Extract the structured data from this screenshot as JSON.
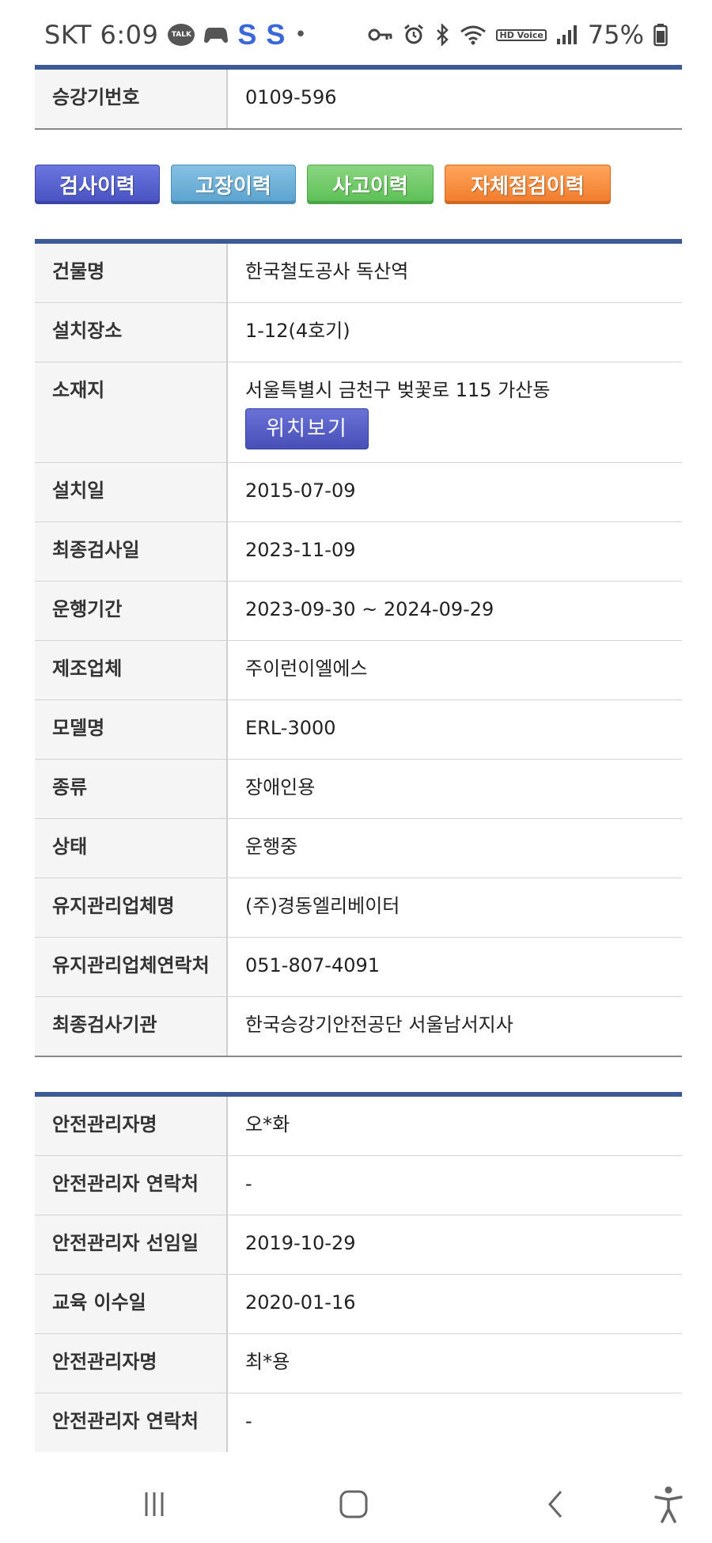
{
  "status_bar": {
    "carrier_time": "SKT 6:09",
    "talk_badge": "TALK",
    "s_icon_1": "S",
    "s_icon_2": "S",
    "dot": "•",
    "hd_voice": "HD Voice",
    "battery": "75%",
    "icons": [
      "talk-icon",
      "game-icon",
      "s-icon",
      "s-icon",
      "key-icon",
      "alarm-icon",
      "bluetooth-icon",
      "wifi-icon",
      "hd-voice-icon",
      "signal-icon",
      "battery-icon"
    ]
  },
  "top_table": {
    "rows": [
      {
        "label": "승강기번호",
        "value": "0109-596"
      }
    ]
  },
  "history_buttons": {
    "inspection": "검사이력",
    "fault": "고장이력",
    "accident": "사고이력",
    "self_check": "자체점검이력"
  },
  "info_table": {
    "building_label": "건물명",
    "building_value": "한국철도공사 독산역",
    "location_label": "설치장소",
    "location_value": "1-12(4호기)",
    "address_label": "소재지",
    "address_value": "서울특별시 금천구 벚꽃로 115 가산동",
    "map_button": "위치보기",
    "rows": [
      {
        "label": "설치일",
        "value": "2015-07-09"
      },
      {
        "label": "최종검사일",
        "value": "2023-11-09"
      },
      {
        "label": "운행기간",
        "value": "2023-09-30 ~ 2024-09-29"
      },
      {
        "label": "제조업체",
        "value": "주이런이엘에스"
      },
      {
        "label": "모델명",
        "value": "ERL-3000"
      },
      {
        "label": "종류",
        "value": "장애인용"
      },
      {
        "label": "상태",
        "value": "운행중"
      },
      {
        "label": "유지관리업체명",
        "value": "(주)경동엘리베이터"
      },
      {
        "label": "유지관리업체연락처",
        "value": "051-807-4091"
      },
      {
        "label": "최종검사기관",
        "value": "한국승강기안전공단 서울남서지사"
      }
    ]
  },
  "manager_table": {
    "rows": [
      {
        "label": "안전관리자명",
        "value": "오*화"
      },
      {
        "label": "안전관리자 연락처",
        "value": "-"
      },
      {
        "label": "안전관리자 선임일",
        "value": "2019-10-29"
      },
      {
        "label": "교육 이수일",
        "value": "2020-01-16"
      },
      {
        "label": "안전관리자명",
        "value": "최*용"
      },
      {
        "label": "안전관리자 연락처",
        "value": "-"
      }
    ]
  },
  "nav_bar": {
    "icons": [
      "recent-apps-icon",
      "home-icon",
      "back-icon",
      "accessibility-icon"
    ]
  }
}
